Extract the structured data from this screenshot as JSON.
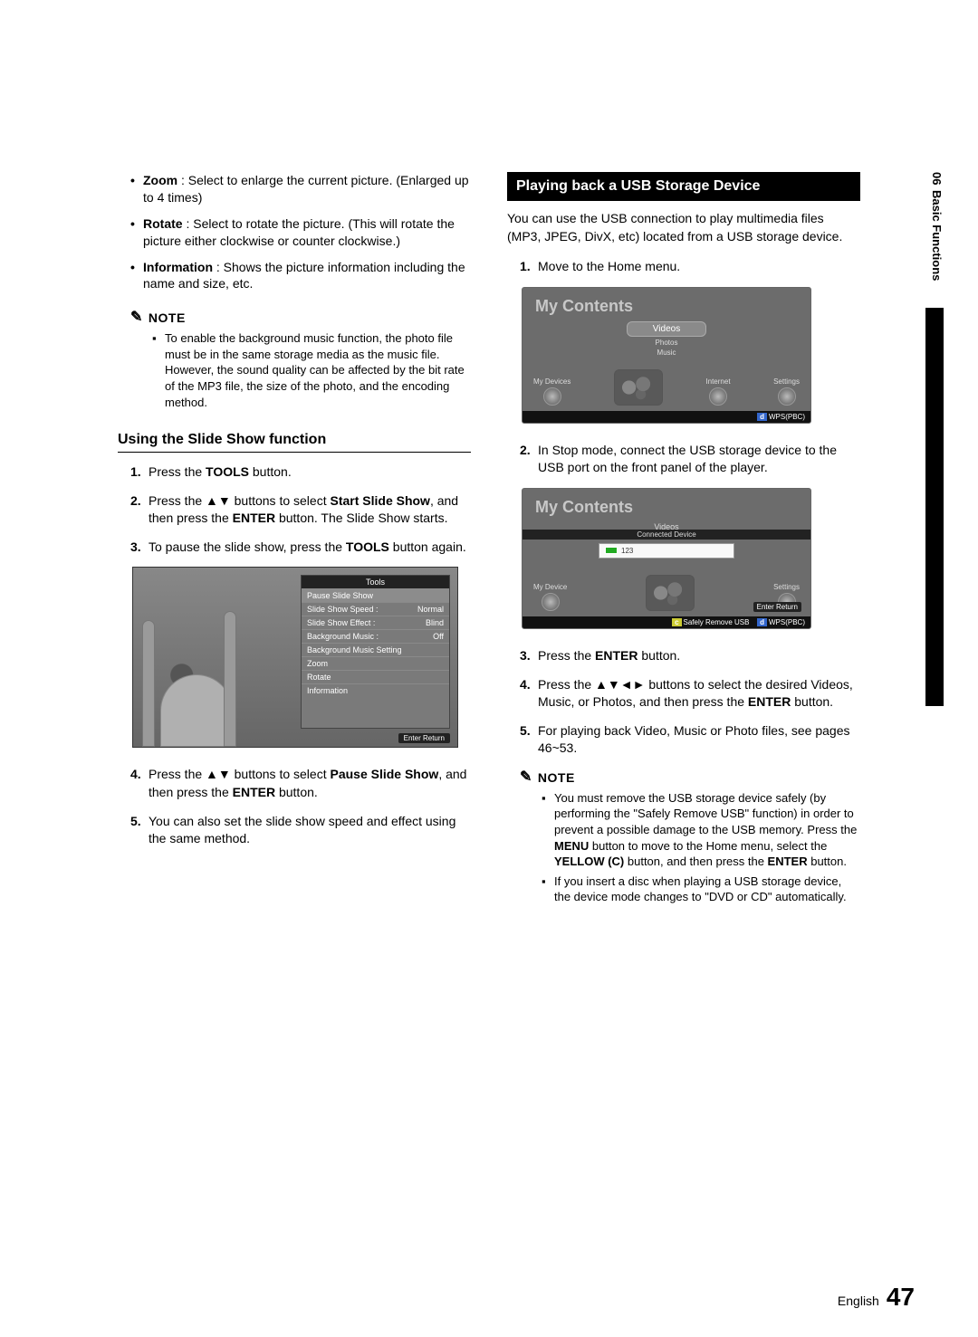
{
  "sideTab": {
    "chapter": "06",
    "title": "Basic Functions"
  },
  "pager": {
    "lang": "English",
    "page": "47"
  },
  "leftCol": {
    "bullets": [
      {
        "bold": "Zoom",
        "rest": " : Select to enlarge the current picture. (Enlarged up to 4 times)"
      },
      {
        "bold": "Rotate",
        "rest": " : Select to rotate the picture. (This will rotate the picture either clockwise or counter clockwise.)"
      },
      {
        "bold": "Information",
        "rest": " : Shows the picture information including the name and size, etc."
      }
    ],
    "noteLabel": "NOTE",
    "noteItems": [
      "To enable the background music function, the photo file must be in the same storage media as the music file. However, the sound quality can be affected by the bit rate of the MP3 file, the size of the photo, and the encoding method."
    ],
    "subhead": "Using the Slide Show function",
    "stepsA": [
      {
        "pre": "Press the ",
        "b1": "TOOLS",
        "post": " button."
      },
      {
        "pre": "Press the ▲▼ buttons to select ",
        "b1": "Start Slide Show",
        "mid": ", and then press the ",
        "b2": "ENTER",
        "post": " button. The Slide Show starts."
      },
      {
        "pre": "To pause the slide show, press the ",
        "b1": "TOOLS",
        "post": " button again."
      }
    ],
    "toolsPanel": {
      "header": "Tools",
      "rows": [
        {
          "label": "Pause Slide Show",
          "value": ""
        },
        {
          "label": "Slide Show Speed    :",
          "value": "Normal"
        },
        {
          "label": "Slide Show Effect    :",
          "value": "Blind"
        },
        {
          "label": "Background Music   :",
          "value": "Off"
        },
        {
          "label": "Background Music Setting",
          "value": ""
        },
        {
          "label": "Zoom",
          "value": ""
        },
        {
          "label": "Rotate",
          "value": ""
        },
        {
          "label": "Information",
          "value": ""
        }
      ],
      "footer": "   Enter      Return"
    },
    "stepsB": [
      {
        "pre": "Press the ▲▼ buttons to select ",
        "b1": "Pause Slide Show",
        "mid": ", and then press the ",
        "b2": "ENTER",
        "post": " button."
      },
      {
        "pre": "You can also set the slide show speed and effect using the same method.",
        "b1": "",
        "post": ""
      }
    ]
  },
  "rightCol": {
    "sectionTitle": "Playing back a USB Storage Device",
    "intro": "You can use the USB connection to play multimedia files (MP3, JPEG, DivX, etc) located from a USB storage device.",
    "steps1": [
      {
        "text": "Move to the Home menu."
      }
    ],
    "osd1": {
      "title": "My Contents",
      "pill": "Videos",
      "sub1": "Photos",
      "sub2": "Music",
      "dockLeft": "My Devices",
      "dockInternet": "Internet",
      "dockSettings": "Settings",
      "hintTag": "d",
      "hintText": "WPS(PBC)"
    },
    "steps2": [
      {
        "text": "In Stop mode, connect the USB storage device to the USB port on the front panel of the player."
      }
    ],
    "osd2": {
      "title": "My Contents",
      "tabLine": "Videos",
      "connected": "Connected Device",
      "deviceLabel": "123",
      "dockLeft": "My Device",
      "dockSettings": "Settings",
      "miniHints": "   Enter      Return",
      "bottomLeftTag": "c",
      "bottomLeft": "Safely Remove USB",
      "bottomRightTag": "d",
      "bottomRight": "WPS(PBC)"
    },
    "steps3": [
      {
        "pre": "Press the ",
        "b1": "ENTER",
        "post": " button."
      },
      {
        "pre": "Press the ▲▼◄► buttons to select the desired Videos, Music, or Photos, and then press the ",
        "b1": "ENTER",
        "post": " button."
      },
      {
        "pre": "For playing back Video, Music or Photo files, see pages 46~53.",
        "b1": "",
        "post": ""
      }
    ],
    "noteLabel": "NOTE",
    "noteItems": [
      {
        "pre": "You must remove the USB storage device safely (by performing the \"Safely Remove USB\" function) in order to prevent a possible damage to the USB memory. Press the ",
        "b1": "MENU",
        "mid": " button to move to the Home menu, select the ",
        "b2": "YELLOW (C)",
        "mid2": " button, and then press the ",
        "b3": "ENTER",
        "post": " button."
      },
      {
        "pre": "If you insert a disc when playing a USB storage device, the device mode changes to \"DVD or CD\" automatically.",
        "b1": "",
        "post": ""
      }
    ]
  }
}
